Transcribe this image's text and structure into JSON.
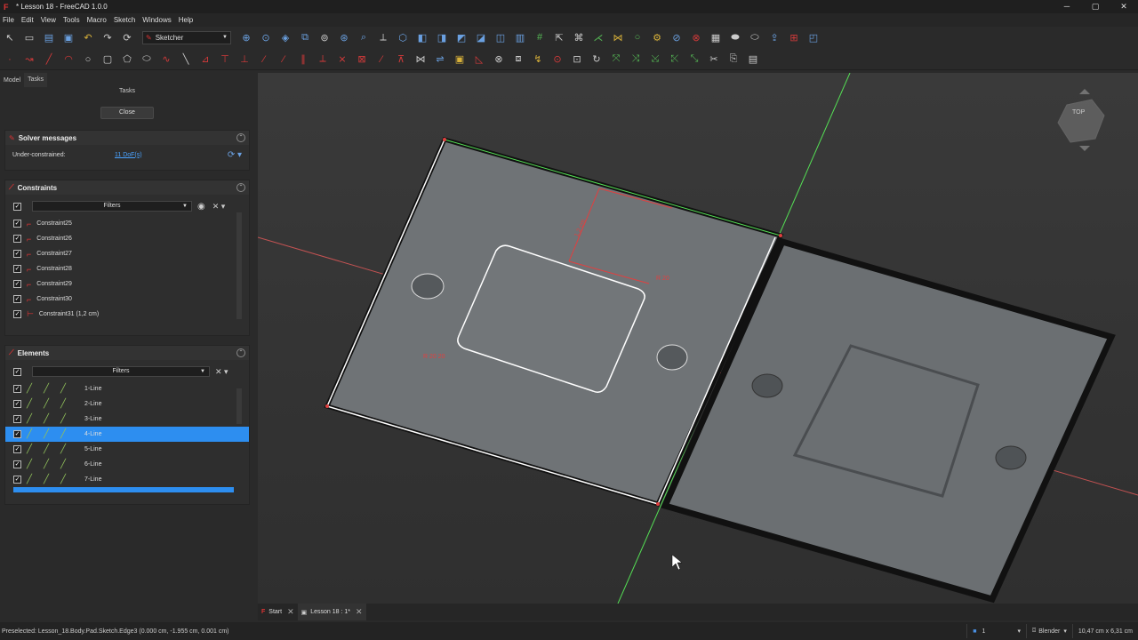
{
  "window": {
    "title": "* Lesson 18 - FreeCAD 1.0.0",
    "minimize": "─",
    "maximize": "▢",
    "close": "✕"
  },
  "menu": [
    "File",
    "Edit",
    "View",
    "Tools",
    "Macro",
    "Sketch",
    "Windows",
    "Help"
  ],
  "toolbar": {
    "workbench": "Sketcher"
  },
  "panel": {
    "tabs": [
      "Model",
      "Tasks"
    ],
    "tasks_title": "Tasks",
    "close_label": "Close",
    "solver": {
      "title": "Solver messages",
      "status_label": "Under-constrained:",
      "status_link": "11 DoF(s)"
    },
    "constraints": {
      "title": "Constraints",
      "filter_label": "Filters",
      "items": [
        "Constraint25",
        "Constraint26",
        "Constraint27",
        "Constraint28",
        "Constraint29",
        "Constraint30",
        "Constraint31 (1,2 cm)"
      ]
    },
    "elements": {
      "title": "Elements",
      "filter_label": "Filters",
      "items": [
        "1-Line",
        "2-Line",
        "3-Line",
        "4-Line",
        "5-Line",
        "6-Line",
        "7-Line"
      ],
      "selected_index": 3
    }
  },
  "bottom_tabs": [
    {
      "label": "Start"
    },
    {
      "label": "Lesson 18 : 1*"
    }
  ],
  "status": {
    "message": "Preselected: Lesson_18.Body.Pad.Sketch.Edge3 (0.000 cm, -1.955 cm, 0.001 cm)",
    "page": "1",
    "nav_style": "Blender",
    "dimensions": "10,47 cm x 6,31 cm"
  },
  "navcube": {
    "face_label": "TOP"
  },
  "colors": {
    "accent": "#2d8ef0",
    "constraint_red": "#e04040",
    "axis_green": "#55e055",
    "axis_red": "#e85a5a"
  }
}
